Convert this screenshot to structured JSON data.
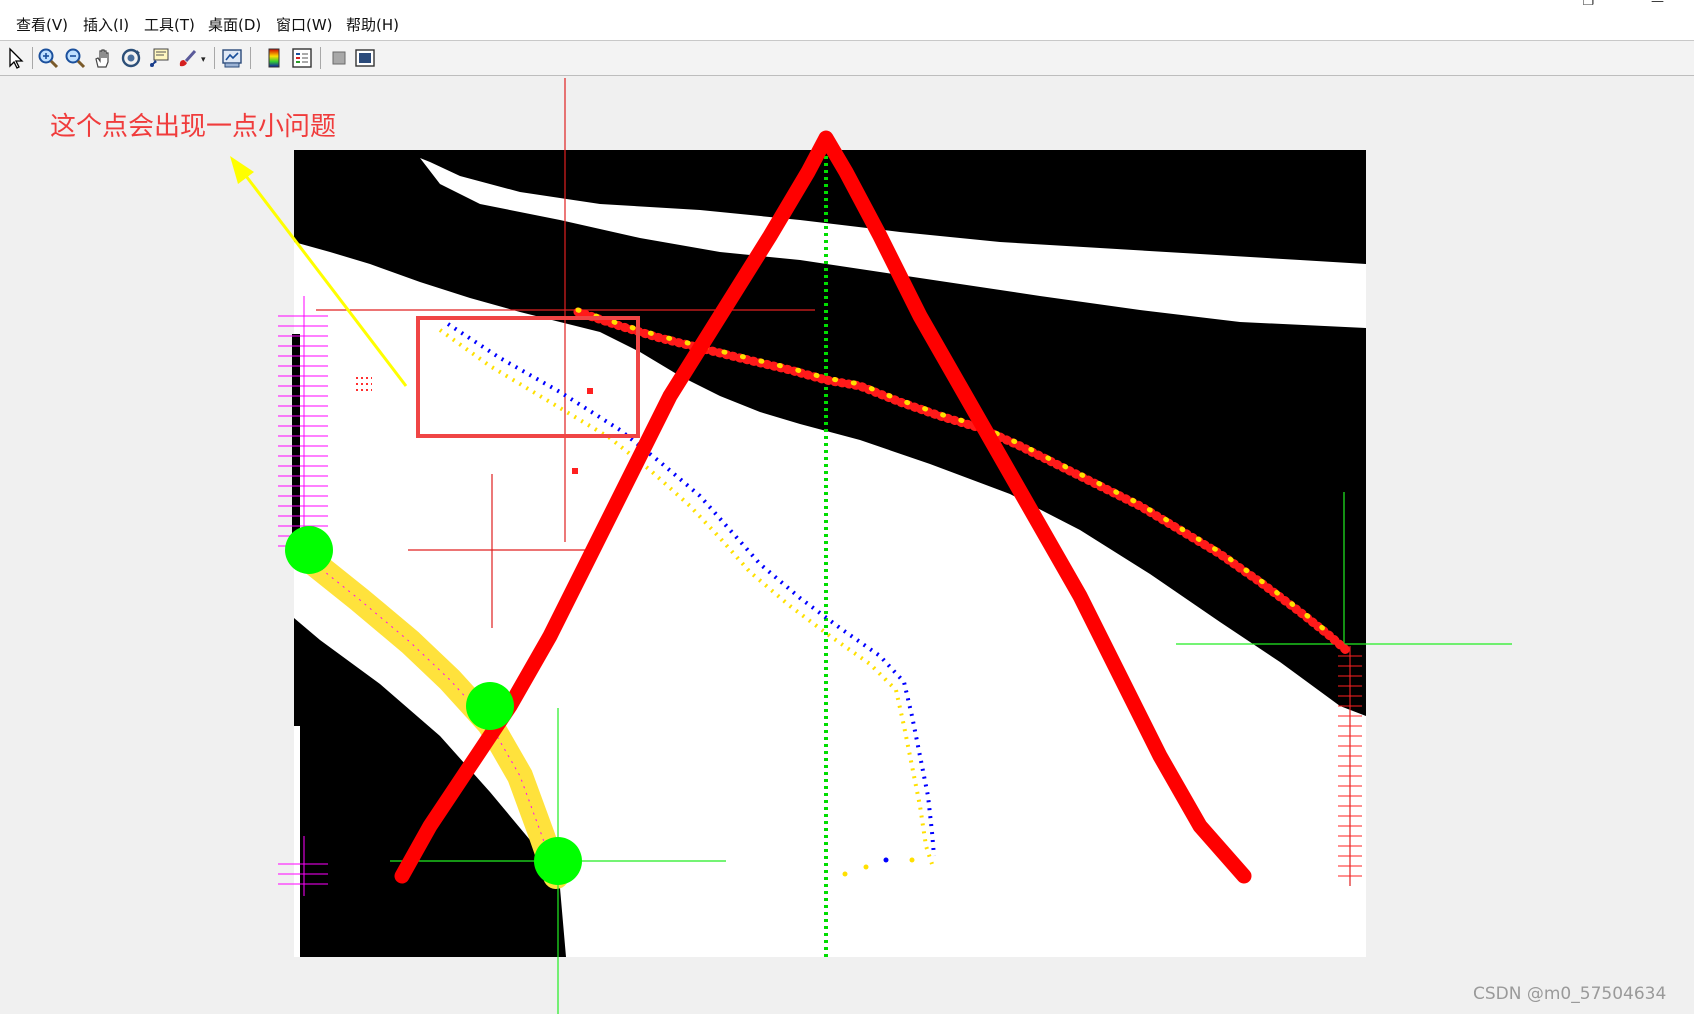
{
  "menu": [
    {
      "id": "view",
      "label": "查看(V)"
    },
    {
      "id": "insert",
      "label": "插入(I)"
    },
    {
      "id": "tools",
      "label": "工具(T)"
    },
    {
      "id": "desktop",
      "label": "桌面(D)"
    },
    {
      "id": "window",
      "label": "窗口(W)"
    },
    {
      "id": "help",
      "label": "帮助(H)"
    }
  ],
  "toolbar": [
    {
      "name": "select-arrow-icon"
    },
    {
      "name": "zoom-in-icon"
    },
    {
      "name": "zoom-out-icon"
    },
    {
      "name": "pan-hand-icon"
    },
    {
      "name": "rotate-3d-icon"
    },
    {
      "name": "data-cursor-icon"
    },
    {
      "name": "brush-icon"
    },
    {
      "name": "link-plot-icon"
    },
    {
      "name": "insert-colorbar-icon"
    },
    {
      "name": "insert-legend-icon"
    },
    {
      "name": "hide-plot-tools-icon"
    },
    {
      "name": "show-plot-tools-icon"
    }
  ],
  "annotation": {
    "text": "这个点会出现一点小问题",
    "color": "#f03c3c",
    "arrow_color": "#ffff00"
  },
  "figure": {
    "colors": {
      "background": "#000000",
      "foreground": "#ffffff",
      "red_lines": "#ff0000",
      "blue_points": "#0000ff",
      "yellow_points": "#ffff00",
      "green_center_line": "#00dd00",
      "green_markers": "#00ff00",
      "magenta_crosses": "#ff00ff",
      "highlight_box": "#f04040"
    }
  },
  "watermark": "CSDN @m0_57504634"
}
